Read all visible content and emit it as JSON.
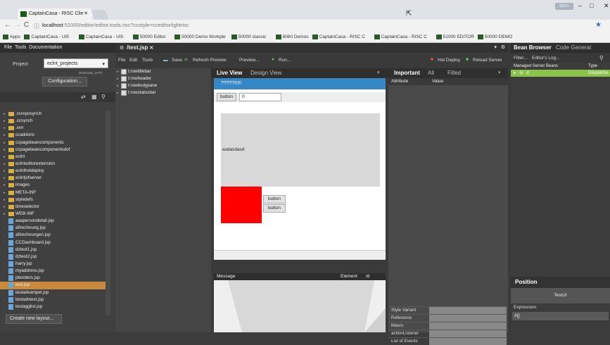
{
  "browser": {
    "tab_title": "CaptainCasa - RISC Clie",
    "tab_close": "✕",
    "user_button": "Björn",
    "url_prefix": "localhost",
    "url_rest": ":51000/editor/editor.tools.risc?ccstyle=cceditorlightrisc",
    "bookmarks": [
      "Apps",
      "CaptainCasa - UI5",
      "CaptainCasa - UI5",
      "50000 Editor",
      "50000 Demo Workple",
      "50000 classic",
      "8080 Demos",
      "CaptainCasa - RISC C",
      "CaptainCasa - RISC C",
      "51000 EDITOR",
      "50000 DEMO"
    ]
  },
  "left": {
    "menu": [
      "File",
      "Tools",
      "Documentation"
    ],
    "project_label": "Project",
    "project_value": "eclnt_projects",
    "version": "20161130_1HT2",
    "configuration_button": "Configuration...",
    "tree": [
      {
        "label": ".ccreposynch",
        "type": "folder"
      },
      {
        "label": ".ccsynch",
        "type": "folder"
      },
      {
        "label": ".svn",
        "type": "folder"
      },
      {
        "label": "ccaddons",
        "type": "folder"
      },
      {
        "label": "ccpagebeancomponents",
        "type": "folder"
      },
      {
        "label": "ccpagebeancomponentsdof",
        "type": "folder"
      },
      {
        "label": "eclnt",
        "type": "folder"
      },
      {
        "label": "eclnteditorextension",
        "type": "folder"
      },
      {
        "label": "eclnthotdeploy",
        "type": "folder"
      },
      {
        "label": "eclntjsfserver",
        "type": "folder"
      },
      {
        "label": "images",
        "type": "folder"
      },
      {
        "label": "META-INF",
        "type": "folder"
      },
      {
        "label": "styledefs",
        "type": "folder"
      },
      {
        "label": "timeselector",
        "type": "folder"
      },
      {
        "label": "WEB-INF",
        "type": "folder"
      },
      {
        "label": "aaapersondetail.jsp",
        "type": "file"
      },
      {
        "label": "afirechnung.jsp",
        "type": "file"
      },
      {
        "label": "afirechnungen.jsp",
        "type": "file"
      },
      {
        "label": "CCDashboard.jsp",
        "type": "file"
      },
      {
        "label": "dztest1.jsp",
        "type": "file"
      },
      {
        "label": "dztest2.jsp",
        "type": "file"
      },
      {
        "label": "harry.jsp",
        "type": "file"
      },
      {
        "label": "myaddress.jsp",
        "type": "file"
      },
      {
        "label": "pborders.jsp",
        "type": "file"
      },
      {
        "label": "test.jsp",
        "type": "file",
        "selected": true
      },
      {
        "label": "testadvampel.jsp",
        "type": "file"
      },
      {
        "label": "testadvtext.jsp",
        "type": "file"
      },
      {
        "label": "testagglist.jsp",
        "type": "file"
      }
    ],
    "new_layout_button": "Create new layout..."
  },
  "editor": {
    "title": "/test.jsp",
    "title_close": "✕",
    "menu": [
      "File",
      "Edit",
      "Tools"
    ],
    "toolbar": {
      "save": "Save",
      "refresh": "Refresh Preview",
      "preview": "Preview...",
      "run": "Run..."
    },
    "hot_deploy": "Hot Deploy",
    "reload_server": "Reload Server",
    "components": [
      "t:rowtitlebar",
      "t:rowheader",
      "t:rowbodypane",
      "t:rowstatusbar"
    ]
  },
  "preview": {
    "tab_live": "Live View",
    "tab_design": "Design View",
    "titlebar_text": "?????!!!!!",
    "button1": "button",
    "input_value": "0",
    "pane_text": "asdasdasd",
    "button2": "button",
    "button3": "button",
    "red_color": "#ff0000",
    "message_header": "Message",
    "element_header": "Element",
    "id_header": "Id"
  },
  "props": {
    "tabs": [
      "Important",
      "All",
      "Filled"
    ],
    "col_attribute": "Attribute",
    "col_value": "Value",
    "bottom_rows": [
      "Style Variant",
      "Reference",
      "Macro",
      "actionListener",
      "List of Events"
    ]
  },
  "bean": {
    "tab_bean": "Bean Browser",
    "tab_code": "Code Generat",
    "filter_label": "Filter...",
    "log_label": "Editor's Log...",
    "managed_label": "Managed Server Beans",
    "type_label": "Type",
    "row_name": "d",
    "row_type": "Dispatche",
    "position_header": "Position",
    "position_value": "TestUI",
    "expression_label": "Expression",
    "expression_value": "#{}"
  }
}
